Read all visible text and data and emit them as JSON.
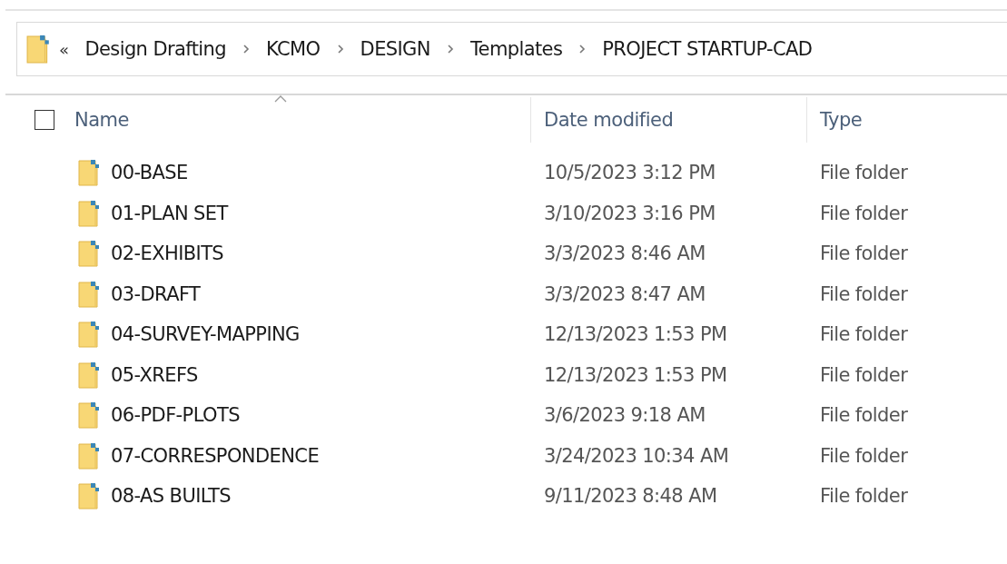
{
  "address_bar": {
    "overflow_marker": "«",
    "breadcrumbs": [
      "Design Drafting",
      "KCMO",
      "DESIGN",
      "Templates",
      "PROJECT STARTUP-CAD"
    ]
  },
  "table": {
    "select_all": {
      "checked": false
    },
    "columns": [
      {
        "label": "Name",
        "sorted": true
      },
      {
        "label": "Date modified",
        "sorted": false
      },
      {
        "label": "Type",
        "sorted": false
      }
    ],
    "rows": [
      {
        "name": "00-BASE",
        "date": "10/5/2023 3:12 PM",
        "type": "File folder"
      },
      {
        "name": "01-PLAN SET",
        "date": "3/10/2023 3:16 PM",
        "type": "File folder"
      },
      {
        "name": "02-EXHIBITS",
        "date": "3/3/2023 8:46 AM",
        "type": "File folder"
      },
      {
        "name": "03-DRAFT",
        "date": "3/3/2023 8:47 AM",
        "type": "File folder"
      },
      {
        "name": "04-SURVEY-MAPPING",
        "date": "12/13/2023 1:53 PM",
        "type": "File folder"
      },
      {
        "name": "05-XREFS",
        "date": "12/13/2023 1:53 PM",
        "type": "File folder"
      },
      {
        "name": "06-PDF-PLOTS",
        "date": "3/6/2023 9:18 AM",
        "type": "File folder"
      },
      {
        "name": "07-CORRESPONDENCE",
        "date": "3/24/2023 10:34 AM",
        "type": "File folder"
      },
      {
        "name": "08-AS BUILTS",
        "date": "9/11/2023 8:48 AM",
        "type": "File folder"
      }
    ]
  }
}
